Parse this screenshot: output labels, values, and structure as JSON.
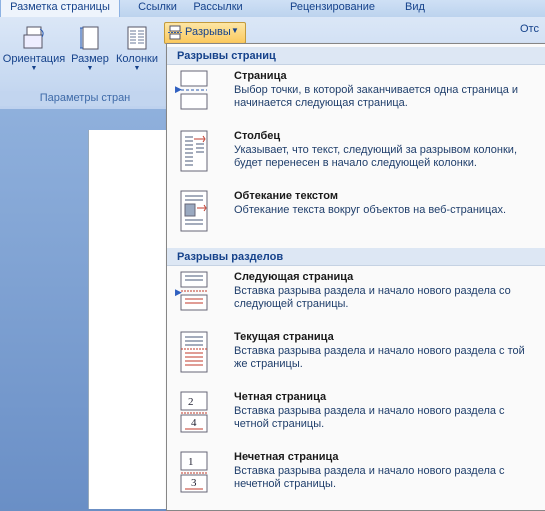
{
  "tabs": [
    "Разметка страницы",
    "Ссылки",
    "Рассылки",
    "Рецензирование",
    "Вид"
  ],
  "ribbon": {
    "buttons": [
      {
        "label": "Ориентация"
      },
      {
        "label": "Размер"
      },
      {
        "label": "Колонки"
      }
    ],
    "group_label": "Параметры стран",
    "right_partial_label": "Отс"
  },
  "breaks_button": {
    "label": "Разрывы",
    "icon": "page-break-icon"
  },
  "menu": {
    "page_breaks_header": "Разрывы страниц",
    "section_breaks_header": "Разрывы разделов",
    "page_items": [
      {
        "title": "Страница",
        "desc": "Выбор точки, в которой заканчивается одна страница и начинается следующая страница.",
        "icon": "page-break-icon"
      },
      {
        "title": "Столбец",
        "desc": "Указывает, что текст, следующий за разрывом колонки, будет перенесен в начало следующей колонки.",
        "icon": "column-break-icon"
      },
      {
        "title": "Обтекание текстом",
        "desc": "Обтекание текста вокруг объектов на веб-страницах.",
        "icon": "text-wrapping-icon"
      }
    ],
    "section_items": [
      {
        "title": "Следующая страница",
        "desc": "Вставка разрыва раздела и начало нового раздела со следующей страницы.",
        "icon": "next-page-icon"
      },
      {
        "title": "Текущая страница",
        "desc": "Вставка разрыва раздела и начало нового раздела с той же страницы.",
        "icon": "continuous-icon"
      },
      {
        "title": "Четная страница",
        "desc": "Вставка разрыва раздела и начало нового раздела с четной страницы.",
        "icon": "even-page-icon",
        "icon_digits": [
          "2",
          "4"
        ]
      },
      {
        "title": "Нечетная страница",
        "desc": "Вставка разрыва раздела и начало нового раздела с нечетной страницы.",
        "icon": "odd-page-icon",
        "icon_digits": [
          "1",
          "3"
        ]
      }
    ]
  },
  "colors": {
    "accent": "#15428b",
    "highlight": "#fbc95e",
    "break_red": "#c0392b"
  }
}
